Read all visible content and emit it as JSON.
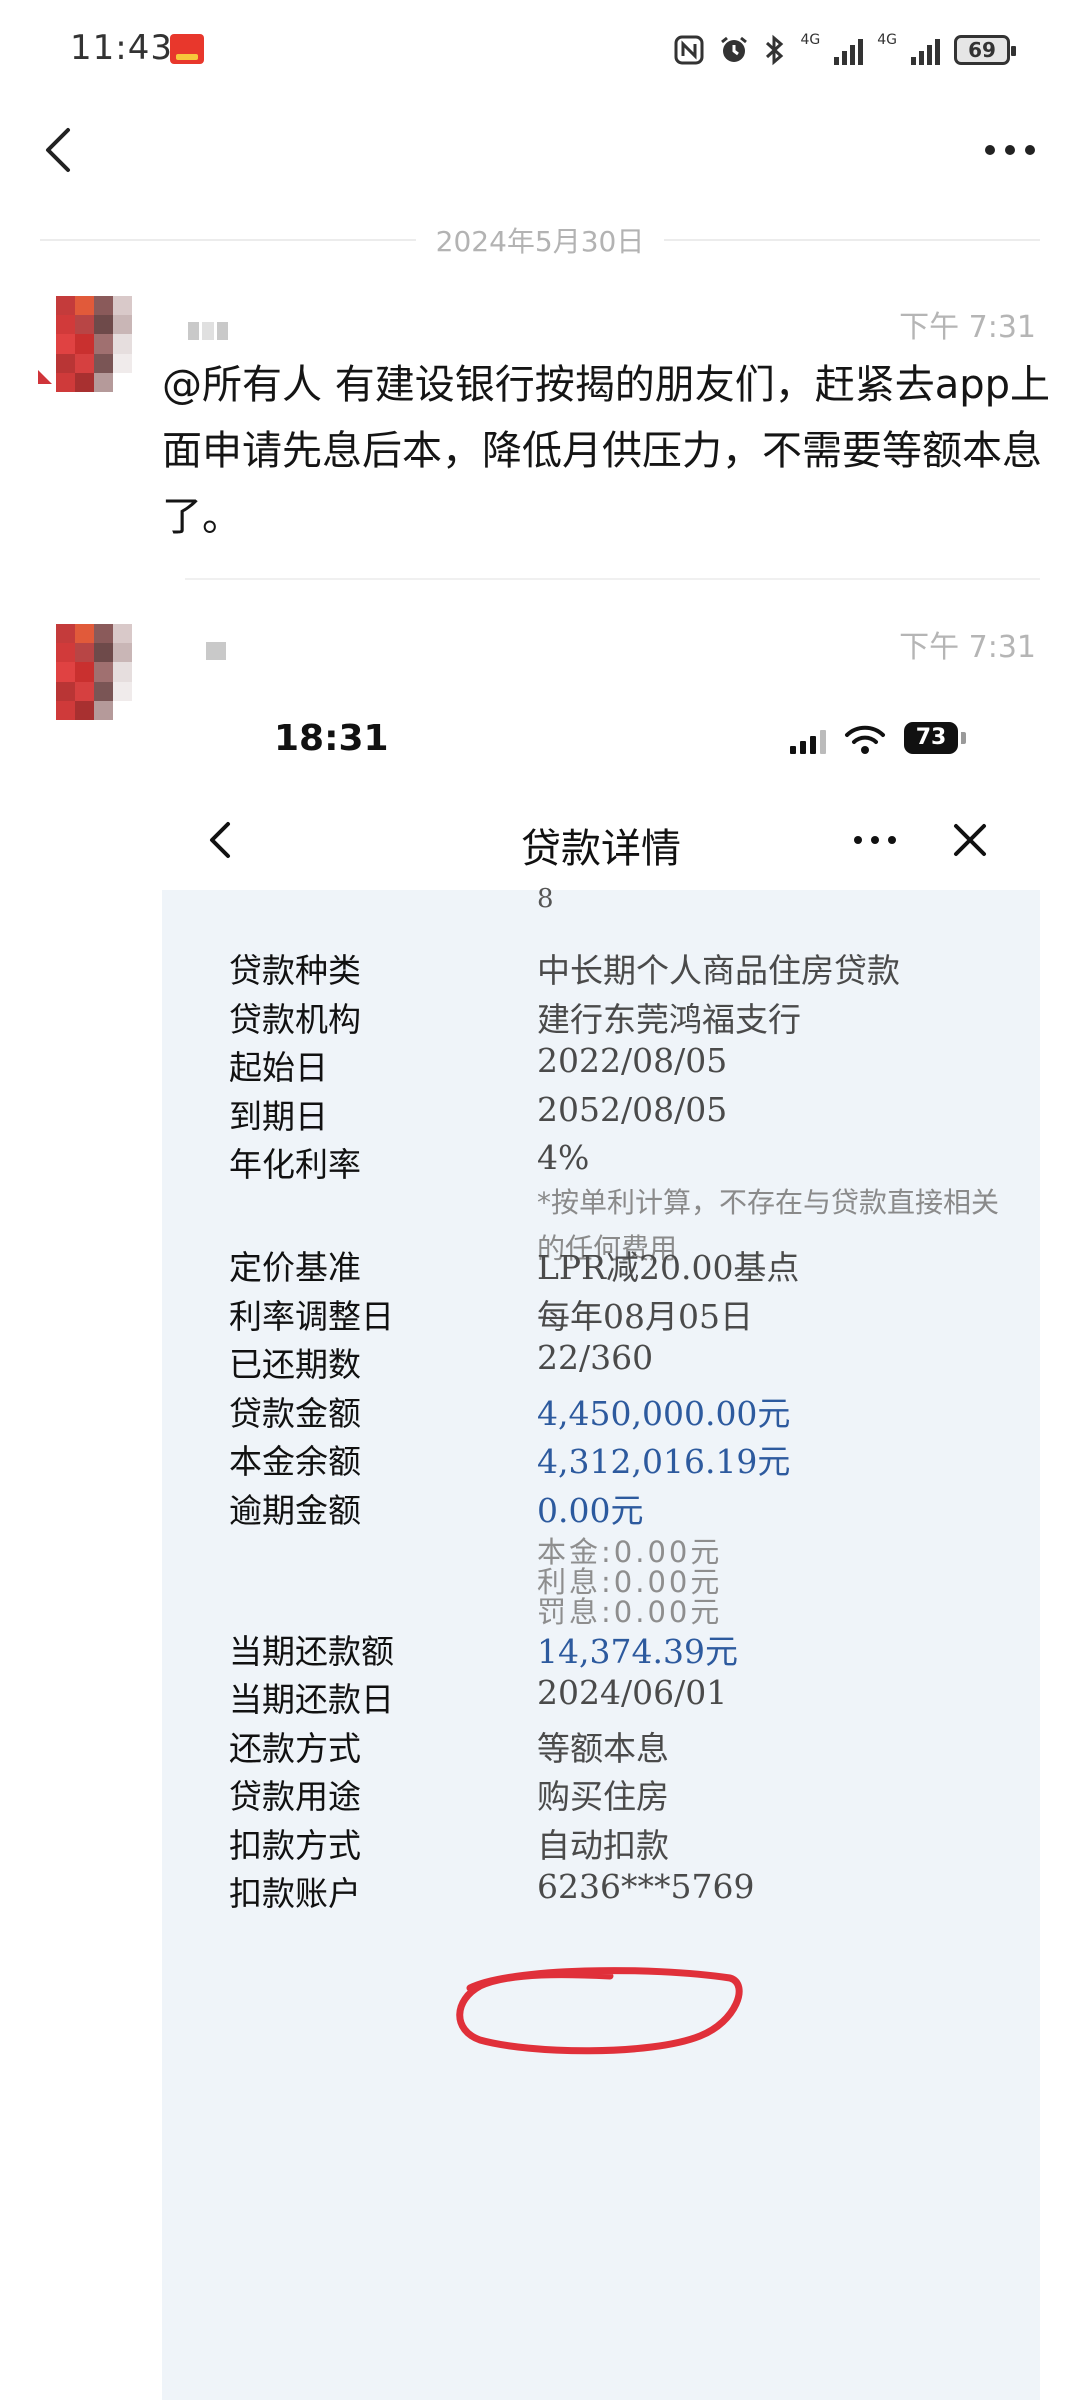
{
  "status_bar": {
    "time": "11:43",
    "network_1": "4G",
    "network_2": "4G",
    "battery": "69"
  },
  "header": {
    "back_icon": "chevron-left-icon",
    "more_icon": "more-dots-icon"
  },
  "date_separator": "2024年5月30日",
  "messages": [
    {
      "time": "下午 7:31",
      "text": "@所有人 有建设银行按揭的朋友们，赶紧去app上面申请先息后本，降低月供压力，不需要等额本息了。"
    },
    {
      "time": "下午 7:31"
    }
  ],
  "screenshot": {
    "status_time": "18:31",
    "battery": "73",
    "nav_title": "贷款详情",
    "top_cut_text": "8",
    "rows": [
      {
        "label": "贷款种类",
        "value": "中长期个人商品住房贷款"
      },
      {
        "label": "贷款机构",
        "value": "建行东莞鸿福支行"
      },
      {
        "label": "起始日",
        "value": "2022/08/05"
      },
      {
        "label": "到期日",
        "value": "2052/08/05"
      },
      {
        "label": "年化利率",
        "value": "4%",
        "note": "*按单利计算，不存在与贷款直接相关的任何费用"
      },
      {
        "label": "定价基准",
        "value": "LPR减20.00基点"
      },
      {
        "label": "利率调整日",
        "value": "每年08月05日"
      },
      {
        "label": "已还期数",
        "value": "22/360"
      },
      {
        "label": "贷款金额",
        "value": "4,450,000.00元"
      },
      {
        "label": "本金余额",
        "value": "4,312,016.19元"
      },
      {
        "label": "逾期金额",
        "value": "0.00元",
        "sub": [
          "本金:0.00元",
          "利息:0.00元",
          "罚息:0.00元"
        ]
      },
      {
        "label": "当期还款额",
        "value": "14,374.39元"
      },
      {
        "label": "当期还款日",
        "value": "2024/06/01"
      },
      {
        "label": "还款方式",
        "value": "等额本息"
      },
      {
        "label": "贷款用途",
        "value": "购买住房"
      },
      {
        "label": "扣款方式",
        "value": "自动扣款"
      },
      {
        "label": "扣款账户",
        "value": "6236***5769"
      }
    ],
    "highlight_color": "#e0303a",
    "accent_blue": "#2d5a9e"
  }
}
